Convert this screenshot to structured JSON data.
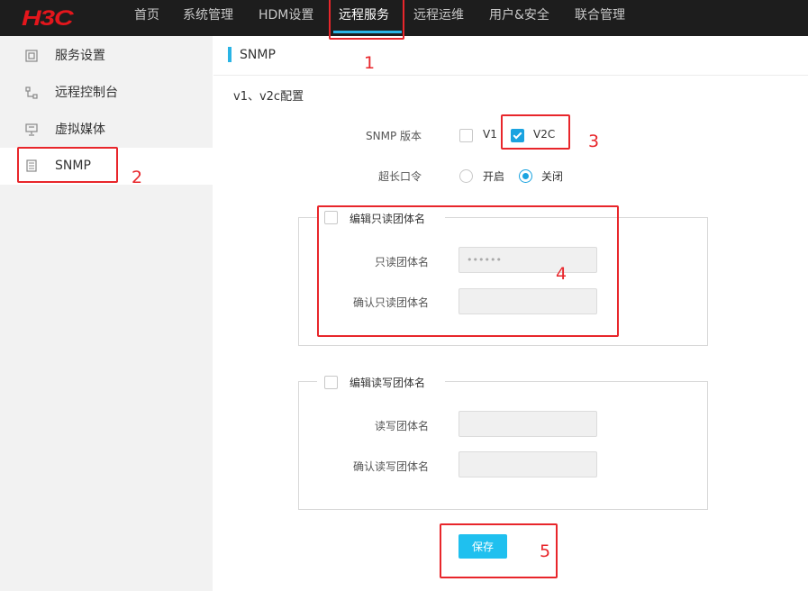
{
  "brand": {
    "logo_text": "H3C",
    "logo_color": "#e4161c"
  },
  "nav": {
    "items": [
      {
        "label": "首页"
      },
      {
        "label": "系统管理"
      },
      {
        "label": "HDM设置"
      },
      {
        "label": "远程服务",
        "active": true
      },
      {
        "label": "远程运维"
      },
      {
        "label": "用户&安全"
      },
      {
        "label": "联合管理"
      }
    ]
  },
  "sidebar": {
    "items": [
      {
        "label": "服务设置",
        "icon": "service-settings-icon"
      },
      {
        "label": "远程控制台",
        "icon": "remote-console-icon"
      },
      {
        "label": "虚拟媒体",
        "icon": "virtual-media-icon"
      },
      {
        "label": "SNMP",
        "icon": "snmp-icon",
        "active": true
      }
    ]
  },
  "main": {
    "title": "SNMP",
    "section_title": "v1、v2c配置",
    "snmp_version": {
      "label": "SNMP 版本",
      "options": [
        {
          "label": "V1",
          "checked": false
        },
        {
          "label": "V2C",
          "checked": true
        }
      ]
    },
    "long_password": {
      "label": "超长口令",
      "options": [
        {
          "label": "开启",
          "selected": false
        },
        {
          "label": "关闭",
          "selected": true
        }
      ]
    },
    "readonly_group": {
      "legend": "编辑只读团体名",
      "checked": false,
      "name_label": "只读团体名",
      "name_value": "••••••",
      "confirm_label": "确认只读团体名",
      "confirm_value": ""
    },
    "readwrite_group": {
      "legend": "编辑读写团体名",
      "checked": false,
      "name_label": "读写团体名",
      "name_value": "",
      "confirm_label": "确认读写团体名",
      "confirm_value": ""
    },
    "save_label": "保存"
  },
  "annotations": {
    "color": "#e8262b",
    "labels": [
      "1",
      "2",
      "3",
      "4",
      "5"
    ]
  },
  "colors": {
    "accent": "#2ab4e5",
    "button": "#1fc0ef",
    "topbar": "#1d1d1d",
    "sidebar": "#f2f2f2"
  }
}
